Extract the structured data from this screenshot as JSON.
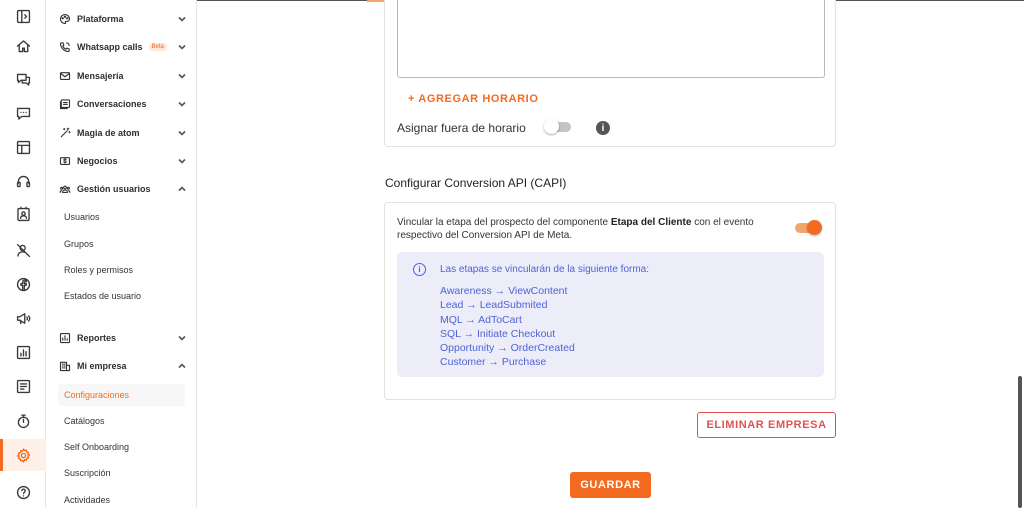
{
  "colors": {
    "accent": "#f26b21",
    "info_blue": "#4f63d6",
    "danger": "#e05252"
  },
  "rail": {
    "items": [
      {
        "icon": "collapse-sidebar-icon"
      },
      {
        "icon": "home-icon"
      },
      {
        "icon": "conversations-icon"
      },
      {
        "icon": "chat-bubble-icon"
      },
      {
        "icon": "layout-icon"
      },
      {
        "icon": "headset-icon"
      },
      {
        "icon": "contact-card-icon"
      },
      {
        "icon": "user-off-icon"
      },
      {
        "icon": "facebook-icon"
      },
      {
        "icon": "megaphone-icon"
      },
      {
        "icon": "bar-chart-icon"
      },
      {
        "icon": "list-icon"
      },
      {
        "icon": "timer-icon"
      },
      {
        "icon": "settings-icon",
        "active": true
      },
      {
        "icon": "help-icon"
      }
    ]
  },
  "sidebar": {
    "items": [
      {
        "label": "Plataforma",
        "icon": "palette-icon"
      },
      {
        "label": "Whatsapp calls",
        "icon": "phone-icon",
        "badge": "Beta"
      },
      {
        "label": "Mensajería",
        "icon": "mail-icon"
      },
      {
        "label": "Conversaciones",
        "icon": "chat-list-icon"
      },
      {
        "label": "Magia de atom",
        "icon": "magic-wand-icon"
      },
      {
        "label": "Negocios",
        "icon": "money-icon"
      },
      {
        "label": "Gestión usuarios",
        "icon": "users-icon",
        "expanded": true
      }
    ],
    "users_sub": [
      "Usuarios",
      "Grupos",
      "Roles y permisos",
      "Estados de usuario"
    ],
    "reports": {
      "label": "Reportes",
      "icon": "report-icon"
    },
    "company": {
      "label": "Mi empresa",
      "icon": "building-icon",
      "expanded": true
    },
    "company_sub": [
      "Configuraciones",
      "Catálogos",
      "Self Onboarding",
      "Suscripción",
      "Actividades"
    ],
    "active_sub": "Configuraciones"
  },
  "schedule": {
    "add_label": "+ AGREGAR HORARIO",
    "assign_label": "Asignar fuera de horario",
    "assign_enabled": false
  },
  "capi": {
    "title": "Configurar Conversion API (CAPI)",
    "description_pre": "Vincular la etapa del prospecto del componente ",
    "description_bold": "Etapa del Cliente",
    "description_post": " con el evento respectivo del Conversion API de Meta.",
    "enabled": true,
    "info_intro": "Las etapas se vincularán de la siguiente forma:",
    "mappings": [
      "Awareness → ViewContent",
      "Lead → LeadSubmited",
      "MQL → AdToCart",
      "SQL → Initiate Checkout",
      "Opportunity → OrderCreated",
      "Customer → Purchase"
    ]
  },
  "actions": {
    "delete_label": "ELIMINAR EMPRESA",
    "save_label": "GUARDAR"
  }
}
